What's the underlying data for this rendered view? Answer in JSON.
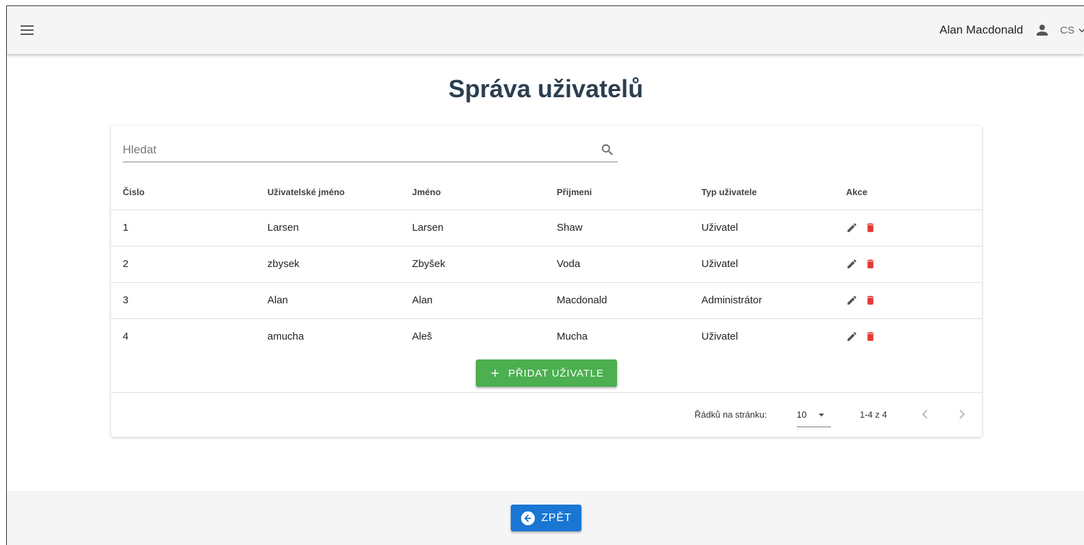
{
  "header": {
    "user_name": "Alan Macdonald",
    "language": "CS"
  },
  "page": {
    "title": "Správa uživatelů"
  },
  "search": {
    "placeholder": "Hledat",
    "value": ""
  },
  "table": {
    "columns": [
      "Čislo",
      "Uživatelské jméno",
      "Jméno",
      "Přijmeni",
      "Typ uživatele",
      "Akce"
    ],
    "rows": [
      {
        "number": "1",
        "username": "Larsen",
        "first_name": "Larsen",
        "last_name": "Shaw",
        "type": "Uživatel"
      },
      {
        "number": "2",
        "username": "zbysek",
        "first_name": "Zbyšek",
        "last_name": "Voda",
        "type": "Uživatel"
      },
      {
        "number": "3",
        "username": "Alan",
        "first_name": "Alan",
        "last_name": "Macdonald",
        "type": "Administrátor"
      },
      {
        "number": "4",
        "username": "amucha",
        "first_name": "Aleš",
        "last_name": "Mucha",
        "type": "Uživatel"
      }
    ]
  },
  "add_button": {
    "label": "PŘIDAT UŽIVATLE"
  },
  "pagination": {
    "rows_per_page_label": "Řádků na stránku:",
    "rows_per_page": "10",
    "range": "1-4 z 4"
  },
  "footer": {
    "back_label": "ZPĚT"
  },
  "colors": {
    "title": "#2c3e50",
    "add_button": "#4caf50",
    "back_button": "#1976d2",
    "delete_icon": "#e53935",
    "edit_icon": "#555555"
  }
}
